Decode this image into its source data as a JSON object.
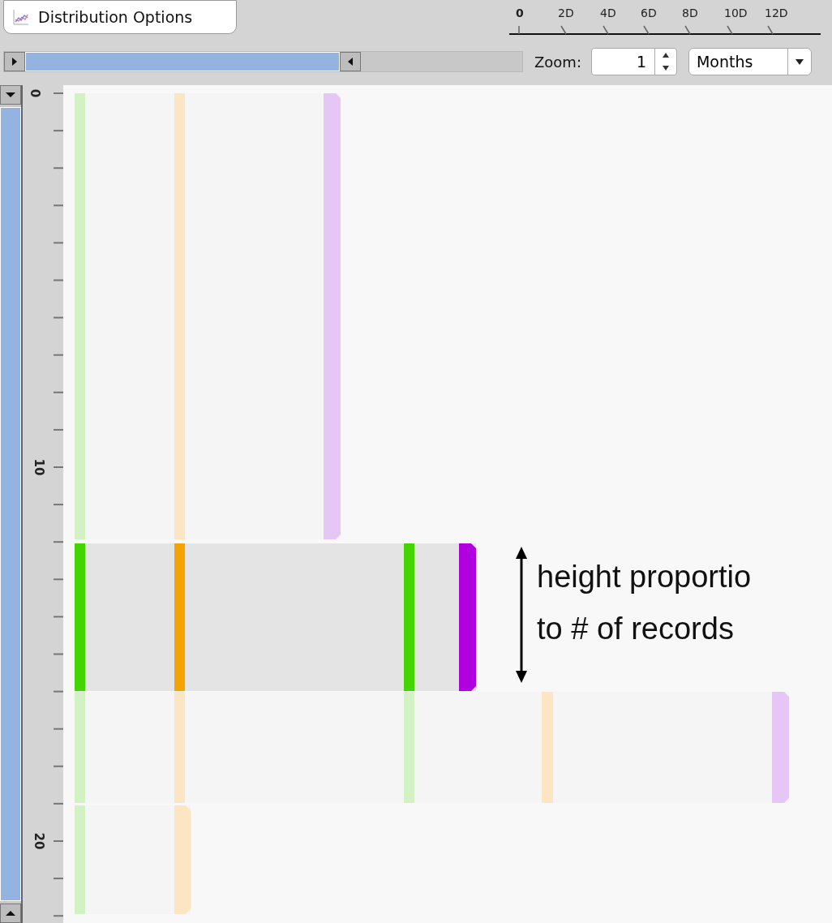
{
  "toolbar": {
    "distribution_button": "Distribution Options"
  },
  "time_ruler": {
    "labels": [
      "0",
      "2D",
      "4D",
      "6D",
      "8D",
      "10D",
      "12D"
    ]
  },
  "zoom": {
    "label": "Zoom:",
    "value": "1"
  },
  "unit_dropdown": {
    "value": "Months"
  },
  "row_ruler": {
    "labels": [
      "0",
      "10",
      "20"
    ]
  },
  "rows": [
    {
      "selected": false,
      "markers": [
        {
          "color": "#d2f2c4"
        },
        {
          "color": "#fce5c3"
        },
        {
          "color": "#e6c6f4"
        }
      ]
    },
    {
      "selected": true,
      "markers": [
        {
          "color": "#44d400"
        },
        {
          "color": "#f5a300"
        },
        {
          "color": "#44d400"
        },
        {
          "color": "#b000e0"
        }
      ]
    },
    {
      "selected": false,
      "markers": [
        {
          "color": "#d2f2c4"
        },
        {
          "color": "#fce5c3"
        },
        {
          "color": "#d2f2c4"
        },
        {
          "color": "#fce5c3"
        },
        {
          "color": "#e6c6f4"
        }
      ]
    },
    {
      "selected": false,
      "markers": [
        {
          "color": "#d2f2c4"
        },
        {
          "color": "#fce5c3"
        }
      ]
    }
  ],
  "annotation": {
    "lines": [
      "height proportio",
      "to # of records"
    ]
  }
}
